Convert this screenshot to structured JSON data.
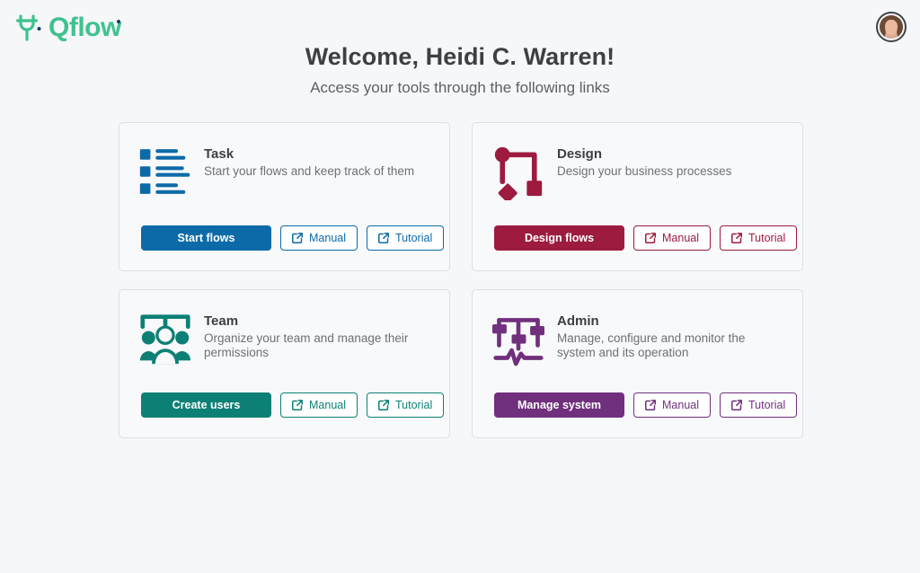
{
  "brand": {
    "logo_text": "Qflow",
    "logo_color": "#3ec28f",
    "logo_accent": "#1b3a6b",
    "logo_icon": "qflow-mark-icon"
  },
  "page": {
    "background": "#f6f7f9",
    "title": "Welcome, Heidi C. Warren!",
    "subtitle": "Access your tools through the following links"
  },
  "user": {
    "avatar_name": "user-avatar"
  },
  "cards": [
    {
      "key": "task",
      "icon": "task-list-icon",
      "title": "Task",
      "description": "Start your flows and keep track of them",
      "color": "#0d6aa8",
      "primary_label": "Start flows",
      "manual_label": "Manual",
      "tutorial_label": "Tutorial"
    },
    {
      "key": "design",
      "icon": "design-flowchart-icon",
      "title": "Design",
      "description": "Design your business processes",
      "color": "#9c1b3f",
      "primary_label": "Design flows",
      "manual_label": "Manual",
      "tutorial_label": "Tutorial"
    },
    {
      "key": "team",
      "icon": "team-people-icon",
      "title": "Team",
      "description": "Organize your team and manage their permissions",
      "color": "#0d8076",
      "primary_label": "Create users",
      "manual_label": "Manual",
      "tutorial_label": "Tutorial"
    },
    {
      "key": "admin",
      "icon": "admin-sliders-icon",
      "title": "Admin",
      "description": "Manage, configure and monitor the system and its operation",
      "color": "#70307d",
      "primary_label": "Manage system",
      "manual_label": "Manual",
      "tutorial_label": "Tutorial"
    }
  ]
}
